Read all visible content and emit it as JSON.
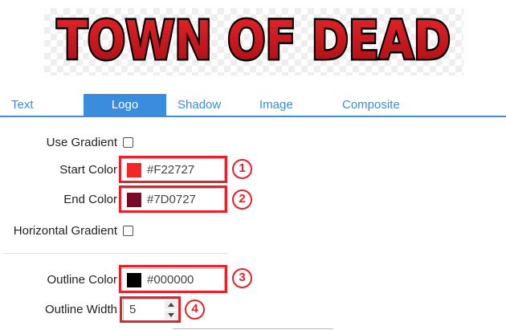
{
  "preview": {
    "logo_text": "TOWN OF DEAD"
  },
  "tabs": [
    {
      "label": "Text"
    },
    {
      "label": "Logo",
      "active": true
    },
    {
      "label": "Shadow"
    },
    {
      "label": "Image"
    },
    {
      "label": "Composite"
    }
  ],
  "form": {
    "use_gradient": {
      "label": "Use Gradient",
      "checked": false
    },
    "start_color": {
      "label": "Start Color",
      "value": "#F22727",
      "swatch": "#f22727"
    },
    "end_color": {
      "label": "End Color",
      "value": "#7D0727",
      "swatch": "#7d0727"
    },
    "horizontal_gradient": {
      "label": "Horizontal Gradient",
      "checked": false
    },
    "outline_color": {
      "label": "Outline Color",
      "value": "#000000",
      "swatch": "#000000"
    },
    "outline_width": {
      "label": "Outline Width",
      "value": "5"
    }
  },
  "annotations": [
    {
      "number": "1"
    },
    {
      "number": "2"
    },
    {
      "number": "3"
    },
    {
      "number": "4"
    }
  ],
  "colors": {
    "accent": "#3a8dde",
    "annotation": "#e8202a",
    "logo_fill": "#c8141c"
  }
}
